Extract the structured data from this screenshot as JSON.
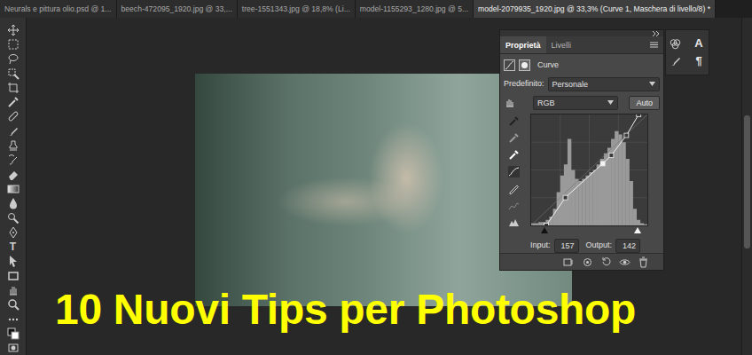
{
  "tabs": [
    {
      "label": "Neurals e pittura olio.psd @ 1...",
      "selected": false
    },
    {
      "label": "beech-472095_1920.jpg @ 33,...",
      "selected": false
    },
    {
      "label": "tree-1551343.jpg @ 18,8% (Li...",
      "selected": false
    },
    {
      "label": "model-1155293_1280.jpg @ 5...",
      "selected": false
    },
    {
      "label": "model-2079935_1920.jpg @ 33,3% (Curve 1, Maschera di livello/8) *",
      "selected": true
    }
  ],
  "toolbar": {
    "type_tool": "T"
  },
  "properties": {
    "tabs": [
      {
        "label": "Proprietà",
        "selected": true
      },
      {
        "label": "Livelli",
        "selected": false
      }
    ],
    "adjustment": "Curve",
    "preset_label": "Predefinito:",
    "preset": "Personale",
    "channel": "RGB",
    "auto_button": "Auto",
    "curve": {
      "points": [
        {
          "input": 33,
          "output": 0,
          "selected": false
        },
        {
          "input": 75,
          "output": 64,
          "selected": false
        },
        {
          "input": 157,
          "output": 142,
          "selected": true
        },
        {
          "input": 176,
          "output": 161,
          "selected": false
        },
        {
          "input": 209,
          "output": 207,
          "selected": false
        },
        {
          "input": 236,
          "output": 255,
          "selected": false
        }
      ],
      "histogram": [
        0.02,
        0.02,
        0.03,
        0.03,
        0.05,
        0.08,
        0.15,
        0.3,
        0.45,
        0.55,
        0.78,
        0.5,
        0.42,
        0.4,
        0.42,
        0.45,
        0.48,
        0.5,
        0.55,
        0.6,
        0.65,
        0.7,
        0.78,
        0.85,
        0.82,
        0.75,
        0.6,
        0.4,
        0.15,
        0.05,
        0.02,
        0.01
      ],
      "black_point_level": 0.12,
      "white_point_level": 0.91
    },
    "input_label": "Input:",
    "input": "157",
    "output_label": "Output:",
    "output": "142"
  },
  "side_panel": {
    "glyphs": [
      "A",
      "¶"
    ]
  },
  "overlay_title": "10 Nuovi Tips per Photoshop"
}
